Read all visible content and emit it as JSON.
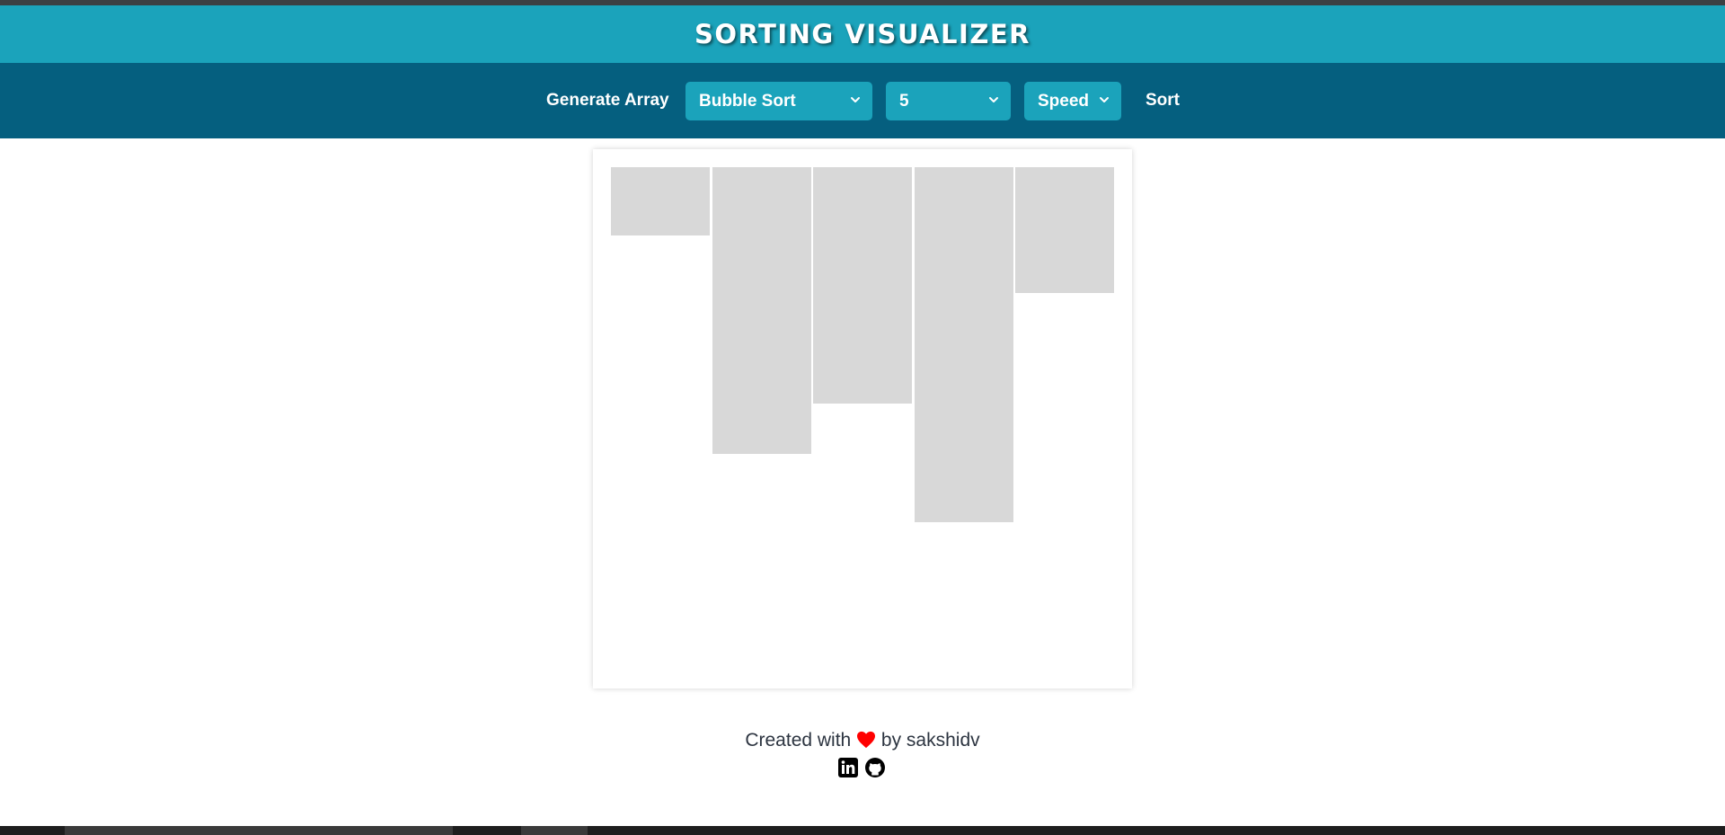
{
  "header": {
    "title": "SORTING VISUALIZER"
  },
  "controls": {
    "generate_label": "Generate Array",
    "algorithm": {
      "selected": "Bubble Sort"
    },
    "size": {
      "selected": "5"
    },
    "speed": {
      "selected": "Speed"
    },
    "sort_label": "Sort"
  },
  "array": {
    "values": [
      54,
      228,
      188,
      282,
      100
    ],
    "max_value": 400,
    "bar_color": "#d8d8d8"
  },
  "footer": {
    "created_prefix": "Created with",
    "created_suffix": "by sakshidv",
    "heart_color": "#ff0000",
    "social_icons": [
      "linkedin-icon",
      "github-icon"
    ]
  },
  "colors": {
    "title_bar": "#1ba3bb",
    "control_bar": "#055f7f",
    "select_bg": "#1ba3bb"
  }
}
